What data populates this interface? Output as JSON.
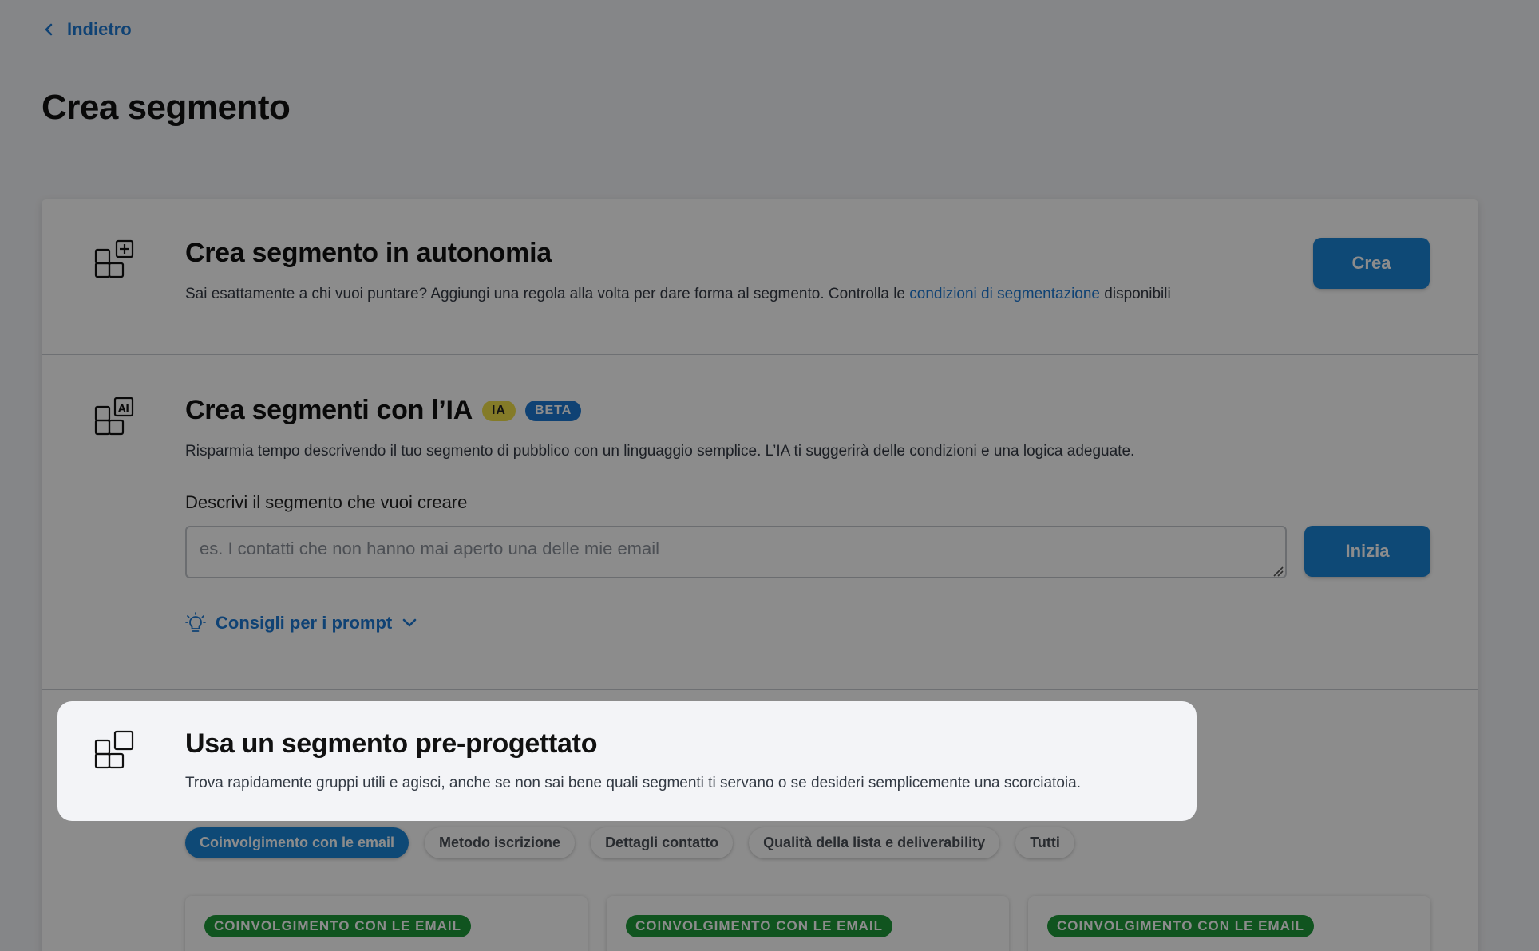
{
  "nav": {
    "back_label": "Indietro"
  },
  "page": {
    "title": "Crea segmento"
  },
  "manual": {
    "title": "Crea segmento in autonomia",
    "desc_prefix": "Sai esattamente a chi vuoi puntare? Aggiungi una regola alla volta per dare forma al segmento. Controlla le ",
    "desc_link": "condizioni di segmentazione",
    "desc_suffix": " disponibili",
    "button_label": "Crea"
  },
  "ai": {
    "title": "Crea segmenti con l’IA",
    "badge_ia": "IA",
    "badge_beta": "BETA",
    "desc": "Risparmia tempo descrivendo il tuo segmento di pubblico con un linguaggio semplice. L’IA ti suggerirà delle condizioni e una logica adeguate.",
    "field_label": "Descrivi il segmento che vuoi creare",
    "placeholder": "es. I contatti che non hanno mai aperto una delle mie email",
    "value": "",
    "button_label": "Inizia",
    "tips_label": "Consigli per i prompt"
  },
  "predesigned": {
    "title": "Usa un segmento pre-progettato",
    "desc": "Trova rapidamente gruppi utili e agisci, anche se non sai bene quali segmenti ti servano o se desideri semplicemente una scorciatoia.",
    "filters": [
      {
        "label": "Coinvolgimento con le email",
        "active": true
      },
      {
        "label": "Metodo iscrizione",
        "active": false
      },
      {
        "label": "Dettagli contatto",
        "active": false
      },
      {
        "label": "Qualità della lista e deliverability",
        "active": false
      },
      {
        "label": "Tutti",
        "active": false
      }
    ],
    "cards": [
      {
        "tag": "COINVOLGIMENTO CON LE EMAIL"
      },
      {
        "tag": "COINVOLGIMENTO CON LE EMAIL"
      },
      {
        "tag": "COINVOLGIMENTO CON LE EMAIL"
      }
    ]
  },
  "colors": {
    "accent": "#1b86d8",
    "link": "#1c78d4",
    "tag_green": "#1e9a3a",
    "badge_yellow": "#f0e04a",
    "overlay": "rgba(0,0,0,0.45)"
  }
}
